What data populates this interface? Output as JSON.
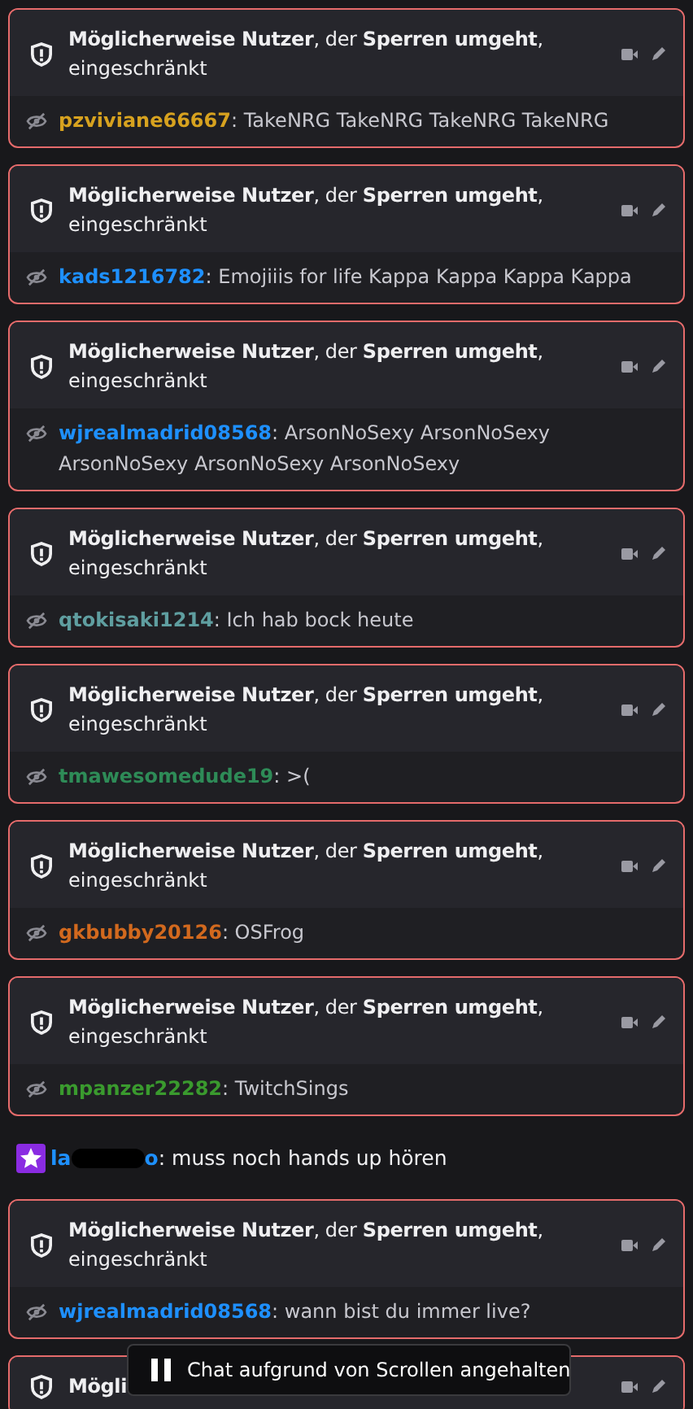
{
  "messages": [
    {
      "kind": "flagged",
      "title": "**Möglicherweise Nutzer**, der **Sperren umgeht**,",
      "subtitle": "eingeschränkt",
      "username": "pzviviane66667",
      "color": "#d7a21f",
      "separator": ":",
      "text": "TakeNRG TakeNRG TakeNRG TakeNRG"
    },
    {
      "kind": "flagged",
      "title": "**Möglicherweise Nutzer**, der **Sperren umgeht**,",
      "subtitle": "eingeschränkt",
      "username": "kads1216782",
      "color": "#1e90ff",
      "separator": ":",
      "text": "Emojiiis for life Kappa Kappa Kappa Kappa"
    },
    {
      "kind": "flagged",
      "title": "**Möglicherweise Nutzer**, der **Sperren umgeht**,",
      "subtitle": "eingeschränkt",
      "username": "wjrealmadrid08568",
      "color": "#1e90ff",
      "separator": ":",
      "text": "ArsonNoSexy ArsonNoSexy ArsonNoSexy ArsonNoSexy ArsonNoSexy"
    },
    {
      "kind": "flagged",
      "title": "**Möglicherweise Nutzer**, der **Sperren umgeht**,",
      "subtitle": "eingeschränkt",
      "username": "qtokisaki1214",
      "color": "#5f9ea0",
      "separator": ":",
      "text": "Ich hab bock heute"
    },
    {
      "kind": "flagged",
      "title": "**Möglicherweise Nutzer**, der **Sperren umgeht**,",
      "subtitle": "eingeschränkt",
      "username": "tmawesomedude19",
      "color": "#2e8b57",
      "separator": ":",
      "text": ">("
    },
    {
      "kind": "flagged",
      "title": "**Möglicherweise Nutzer**, der **Sperren umgeht**,",
      "subtitle": "eingeschränkt",
      "username": "gkbubby20126",
      "color": "#d2691e",
      "separator": ":",
      "text": "OSFrog"
    },
    {
      "kind": "flagged",
      "title": "**Möglicherweise Nutzer**, der **Sperren umgeht**,",
      "subtitle": "eingeschränkt",
      "username": "mpanzer22282",
      "color": "#3a9a2e",
      "separator": ":",
      "text": "TwitchSings"
    },
    {
      "kind": "plain",
      "username_start": "la",
      "username_end": "o",
      "color": "#1e90ff",
      "separator": ":",
      "text": "muss noch hands up hören"
    },
    {
      "kind": "flagged",
      "title": "**Möglicherweise Nutzer**, der **Sperren umgeht**,",
      "subtitle": "eingeschränkt",
      "username": "wjrealmadrid08568",
      "color": "#1e90ff",
      "separator": ":",
      "text": "wann bist du immer live?"
    },
    {
      "kind": "flagged",
      "title": "**Mögli**"
    }
  ],
  "paused_banner": {
    "text": "Chat aufgrund von Scrollen angehalten"
  }
}
